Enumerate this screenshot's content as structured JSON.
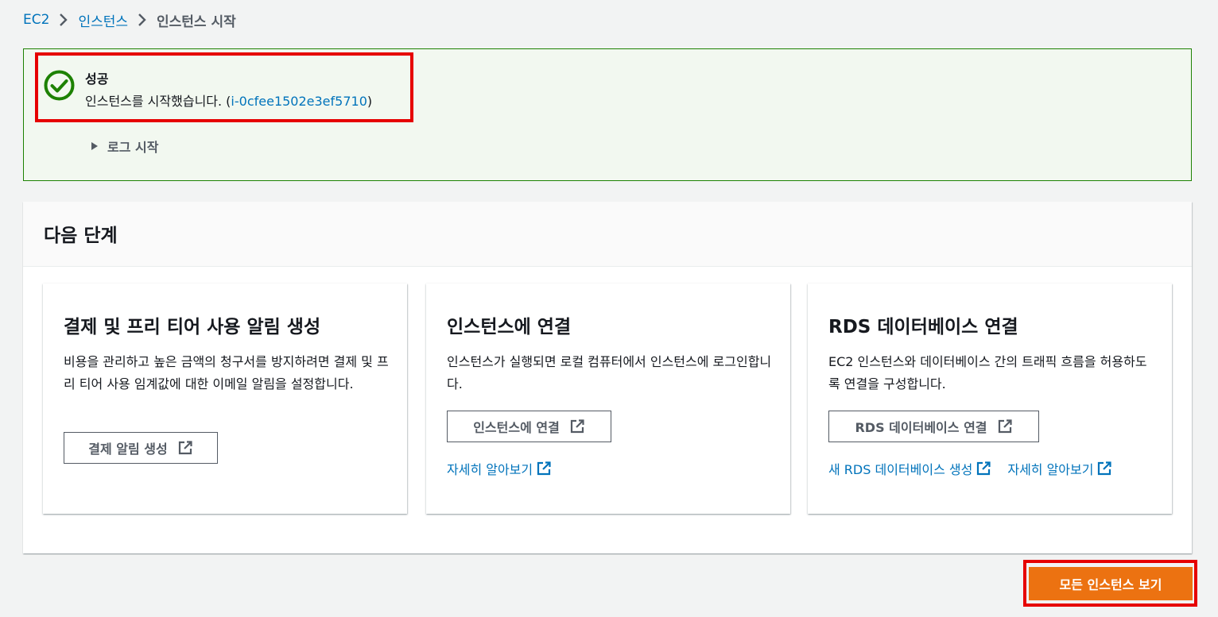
{
  "breadcrumb": {
    "items": [
      "EC2",
      "인스턴스"
    ],
    "current": "인스턴스 시작"
  },
  "flash": {
    "type": "success",
    "title": "성공",
    "message_prefix": "인스턴스를 시작했습니다. (",
    "instance_id": "i-0cfee1502e3ef5710",
    "message_suffix": ")",
    "expand_label": "로그 시작"
  },
  "next_steps": {
    "title": "다음 단계",
    "cards": [
      {
        "title": "결제 및 프리 티어 사용 알림 생성",
        "description": "비용을 관리하고 높은 금액의 청구서를 방지하려면 결제 및 프리 티어 사용 임계값에 대한 이메일 알림을 설정합니다.",
        "button": "결제 알림 생성"
      },
      {
        "title": "인스턴스에 연결",
        "description": "인스턴스가 실행되면 로컬 컴퓨터에서 인스턴스에 로그인합니다.",
        "button": "인스턴스에 연결",
        "links": [
          "자세히 알아보기"
        ]
      },
      {
        "title": "RDS 데이터베이스 연결",
        "description": "EC2 인스턴스와 데이터베이스 간의 트래픽 흐름을 허용하도록 연결을 구성합니다.",
        "button": "RDS 데이터베이스 연결",
        "links": [
          "새 RDS 데이터베이스 생성",
          "자세히 알아보기"
        ]
      }
    ]
  },
  "primary_action": "모든 인스턴스 보기",
  "colors": {
    "link": "#0073bb",
    "success": "#1d8102",
    "success_bg": "#f2f8f0",
    "primary": "#ec7211",
    "highlight": "#e60000"
  },
  "icons": {
    "status": "check-circle-icon",
    "breadcrumb_separator": "chevron-right-icon",
    "expand": "caret-right-icon",
    "external": "external-link-icon"
  }
}
